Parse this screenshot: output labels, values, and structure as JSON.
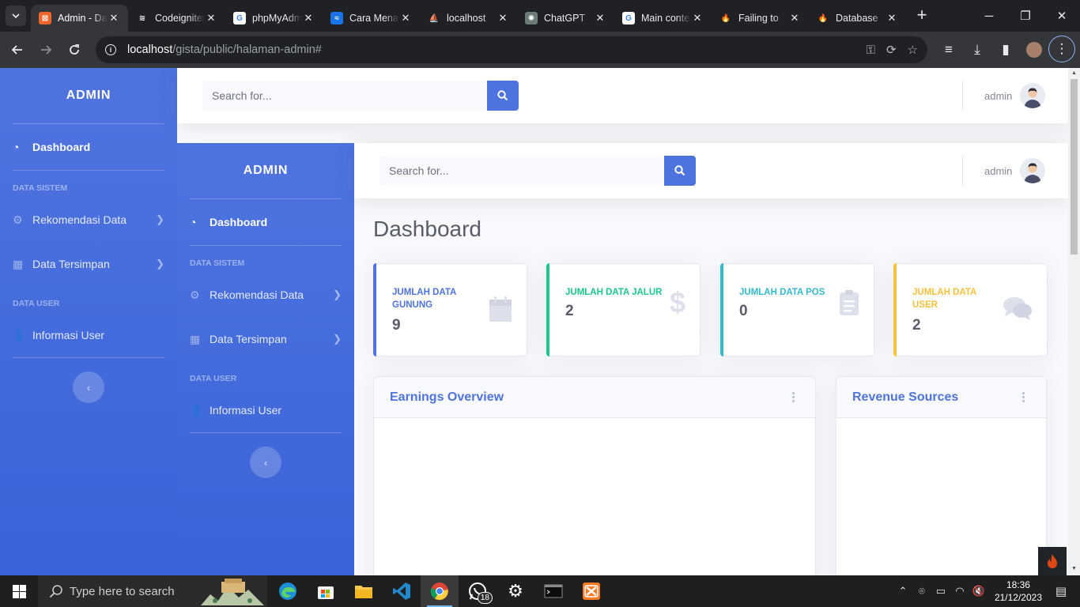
{
  "browser": {
    "tabs": [
      {
        "title": "Admin - Dashboard",
        "fav_color": "#f06529",
        "fav_glyph": "⊠",
        "active": true
      },
      {
        "title": "Codeigniter",
        "fav_color": "#202124",
        "fav_glyph": "≋",
        "active": false
      },
      {
        "title": "phpMyAdmin",
        "fav_color": "#ffffff",
        "fav_glyph": "G",
        "active": false
      },
      {
        "title": "Cara Menampilkan",
        "fav_color": "#1a73e8",
        "fav_glyph": "≈",
        "active": false
      },
      {
        "title": "localhost",
        "fav_color": "#202124",
        "fav_glyph": "⛵",
        "active": false
      },
      {
        "title": "ChatGPT",
        "fav_color": "#6b7c74",
        "fav_glyph": "✺",
        "active": false
      },
      {
        "title": "Main content",
        "fav_color": "#ffffff",
        "fav_glyph": "G",
        "active": false
      },
      {
        "title": "Failing to",
        "fav_color": "#202124",
        "fav_glyph": "🔥",
        "active": false
      },
      {
        "title": "Database",
        "fav_color": "#202124",
        "fav_glyph": "🔥",
        "active": false
      }
    ],
    "url_host": "localhost",
    "url_path": "/gista/public/halaman-admin#"
  },
  "outer": {
    "brand": "ADMIN",
    "search_placeholder": "Search for...",
    "username": "admin"
  },
  "sidebar": {
    "brand": "ADMIN",
    "dashboard": "Dashboard",
    "heading_sistem": "DATA SISTEM",
    "rekomendasi": "Rekomendasi Data",
    "tersimpan": "Data Tersimpan",
    "heading_user": "DATA USER",
    "informasi": "Informasi User"
  },
  "inner": {
    "search_placeholder": "Search for...",
    "username": "admin",
    "page_title": "Dashboard"
  },
  "stats": [
    {
      "label": "JUMLAH DATA GUNUNG",
      "value": "9",
      "color": "#4e73df",
      "icon": "calendar-icon"
    },
    {
      "label": "JUMLAH DATA JALUR",
      "value": "2",
      "color": "#1cc88a",
      "icon": "dollar-icon"
    },
    {
      "label": "JUMLAH DATA POS",
      "value": "0",
      "color": "#36b9cc",
      "icon": "clipboard-icon"
    },
    {
      "label": "JUMLAH DATA USER",
      "value": "2",
      "color": "#f6c23e",
      "icon": "comments-icon"
    }
  ],
  "cards": {
    "earnings": "Earnings Overview",
    "revenue": "Revenue Sources"
  },
  "taskbar": {
    "search_placeholder": "Type here to search",
    "whatsapp_badge": "18",
    "time": "18:36",
    "date": "21/12/2023"
  }
}
